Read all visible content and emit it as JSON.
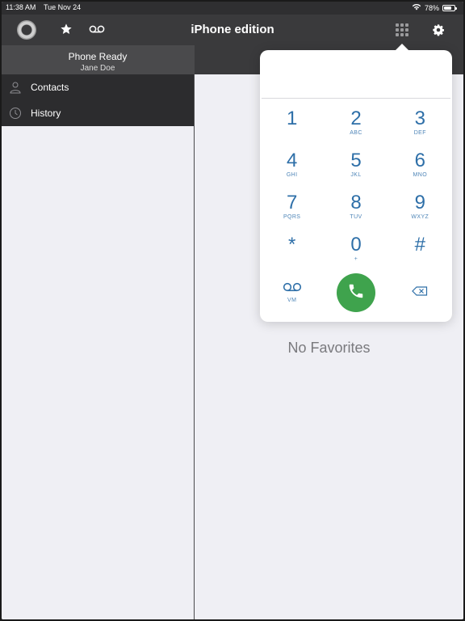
{
  "status_bar": {
    "time": "11:38 AM",
    "date": "Tue Nov 24",
    "battery": "78%",
    "battery_level": 0.78
  },
  "nav": {
    "title": "iPhone edition",
    "icons": [
      "logo-icon",
      "star-icon",
      "voicemail-icon",
      "keypad-icon",
      "gear-icon"
    ]
  },
  "sidebar": {
    "status": "Phone Ready",
    "user": "Jane Doe",
    "items": [
      {
        "label": "Contacts",
        "icon": "person-icon"
      },
      {
        "label": "History",
        "icon": "clock-icon"
      }
    ]
  },
  "main": {
    "empty_text": "No Favorites"
  },
  "dialpad": {
    "display_value": "",
    "keys": [
      [
        {
          "digit": "1",
          "letters": ""
        },
        {
          "digit": "2",
          "letters": "ABC"
        },
        {
          "digit": "3",
          "letters": "DEF"
        }
      ],
      [
        {
          "digit": "4",
          "letters": "GHI"
        },
        {
          "digit": "5",
          "letters": "JKL"
        },
        {
          "digit": "6",
          "letters": "MNO"
        }
      ],
      [
        {
          "digit": "7",
          "letters": "PQRS"
        },
        {
          "digit": "8",
          "letters": "TUV"
        },
        {
          "digit": "9",
          "letters": "WXYZ"
        }
      ],
      [
        {
          "digit": "*",
          "letters": ""
        },
        {
          "digit": "0",
          "letters": "+"
        },
        {
          "digit": "#",
          "letters": ""
        }
      ]
    ],
    "bottom": {
      "vm_label": "VM"
    },
    "accent_color": "#2e6fa8",
    "call_color": "#3fa34d"
  }
}
